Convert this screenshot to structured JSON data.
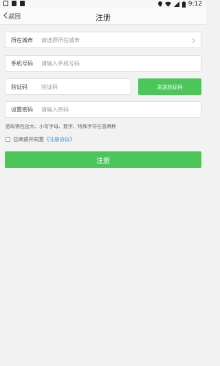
{
  "status_bar": {
    "time": "9:12"
  },
  "header": {
    "back_label": "返回",
    "title": "注册"
  },
  "form": {
    "city": {
      "label": "所在城市",
      "placeholder": "请选择所在城市"
    },
    "phone": {
      "label": "手机号码",
      "placeholder": "请输入手机号码"
    },
    "code": {
      "label": "验证码",
      "placeholder": "验证码",
      "send_label": "发送验证码"
    },
    "password": {
      "label": "设置密码",
      "placeholder": "请输入密码"
    },
    "password_hint": "密码需包含大、小写字母、数字、特殊字符任意两种",
    "agree_text": "已阅读并同意",
    "agreement_link": "《注册协议》",
    "submit_label": "注册"
  },
  "colors": {
    "accent_green": "#4cc65a",
    "link_blue": "#3a8ee6",
    "background": "#f2f2f2"
  }
}
